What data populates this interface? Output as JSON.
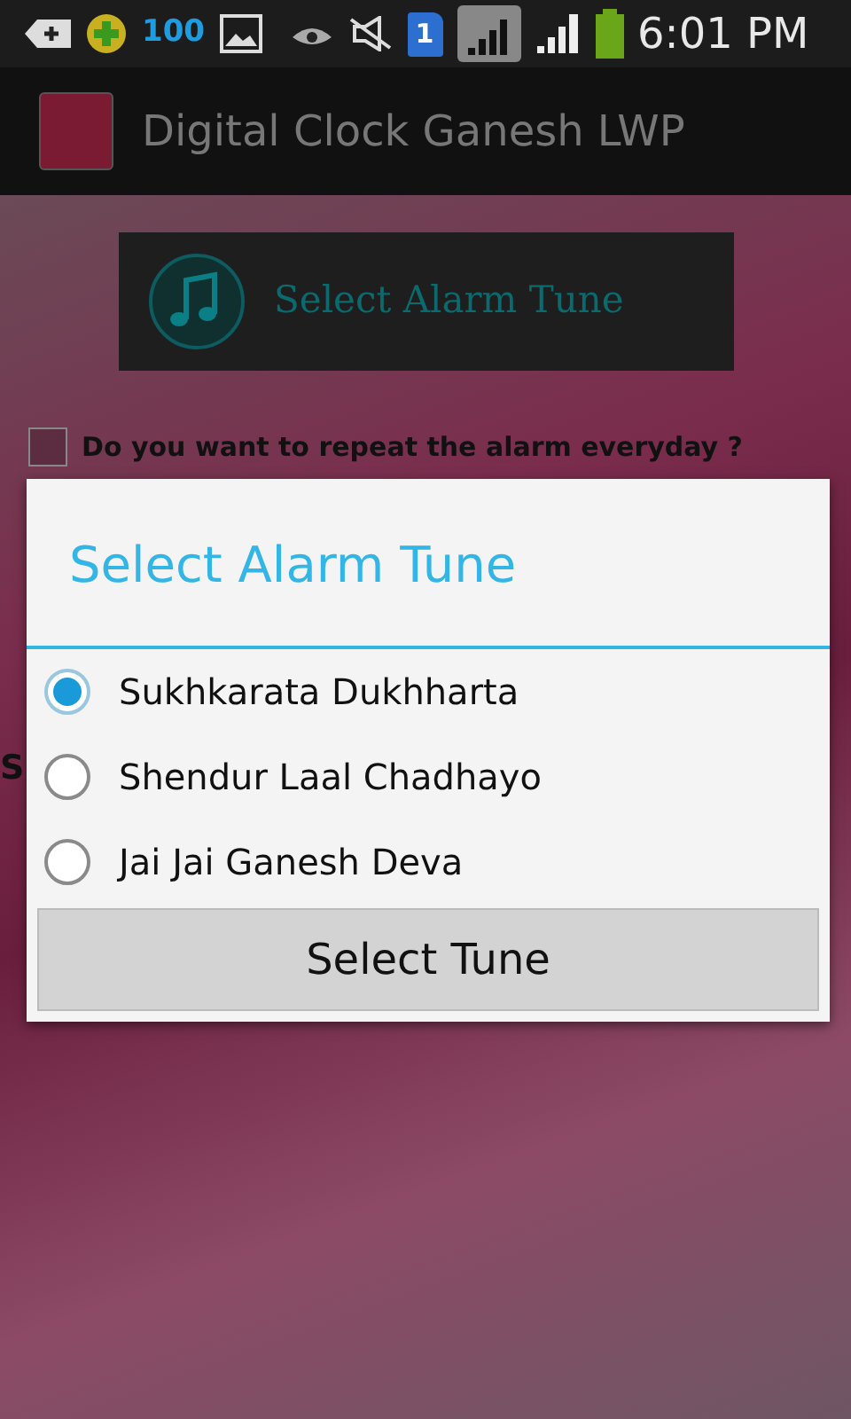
{
  "status_bar": {
    "battery_percent": "100",
    "sim_number": "1",
    "time": "6:01 PM"
  },
  "app_bar": {
    "title": "Digital Clock Ganesh LWP"
  },
  "banner": {
    "label": "Select Alarm Tune"
  },
  "repeat_option": {
    "label": "Do you want to repeat the alarm everyday ?",
    "checked": false
  },
  "background_fragment": "S",
  "dialog": {
    "title": "Select Alarm Tune",
    "options": [
      {
        "label": "Sukhkarata Dukhharta",
        "selected": true
      },
      {
        "label": "Shendur Laal Chadhayo",
        "selected": false
      },
      {
        "label": "Jai Jai Ganesh Deva",
        "selected": false
      }
    ],
    "button": "Select Tune"
  }
}
